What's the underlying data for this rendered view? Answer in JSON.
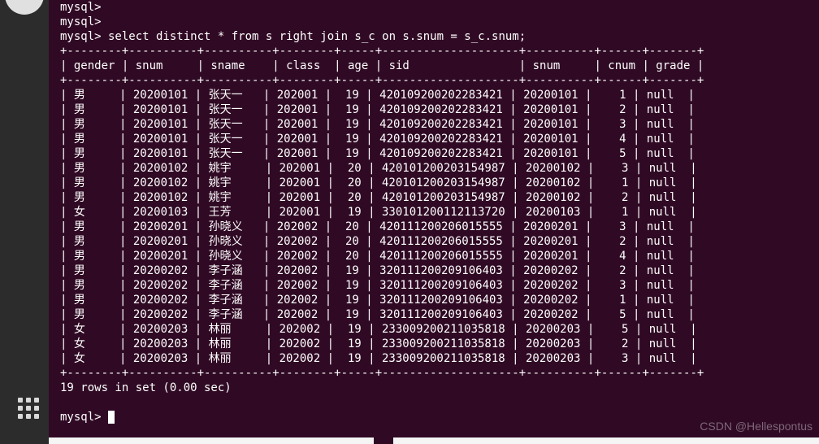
{
  "prompts": [
    "mysql>",
    "mysql>",
    "mysql> select distinct * from s right join s_c on s.snum = s_c.snum;"
  ],
  "table": {
    "headers": [
      "gender",
      "snum",
      "sname",
      "class",
      "age",
      "sid",
      "snum",
      "cnum",
      "grade"
    ],
    "rows": [
      [
        "男",
        "20200101",
        "张天一",
        "202001",
        "19",
        "420109200202283421",
        "20200101",
        "1",
        "null"
      ],
      [
        "男",
        "20200101",
        "张天一",
        "202001",
        "19",
        "420109200202283421",
        "20200101",
        "2",
        "null"
      ],
      [
        "男",
        "20200101",
        "张天一",
        "202001",
        "19",
        "420109200202283421",
        "20200101",
        "3",
        "null"
      ],
      [
        "男",
        "20200101",
        "张天一",
        "202001",
        "19",
        "420109200202283421",
        "20200101",
        "4",
        "null"
      ],
      [
        "男",
        "20200101",
        "张天一",
        "202001",
        "19",
        "420109200202283421",
        "20200101",
        "5",
        "null"
      ],
      [
        "男",
        "20200102",
        "姚宇",
        "202001",
        "20",
        "420101200203154987",
        "20200102",
        "3",
        "null"
      ],
      [
        "男",
        "20200102",
        "姚宇",
        "202001",
        "20",
        "420101200203154987",
        "20200102",
        "1",
        "null"
      ],
      [
        "男",
        "20200102",
        "姚宇",
        "202001",
        "20",
        "420101200203154987",
        "20200102",
        "2",
        "null"
      ],
      [
        "女",
        "20200103",
        "王芳",
        "202001",
        "19",
        "330101200112113720",
        "20200103",
        "1",
        "null"
      ],
      [
        "男",
        "20200201",
        "孙晓义",
        "202002",
        "20",
        "420111200206015555",
        "20200201",
        "3",
        "null"
      ],
      [
        "男",
        "20200201",
        "孙晓义",
        "202002",
        "20",
        "420111200206015555",
        "20200201",
        "2",
        "null"
      ],
      [
        "男",
        "20200201",
        "孙晓义",
        "202002",
        "20",
        "420111200206015555",
        "20200201",
        "4",
        "null"
      ],
      [
        "男",
        "20200202",
        "李子涵",
        "202002",
        "19",
        "320111200209106403",
        "20200202",
        "2",
        "null"
      ],
      [
        "男",
        "20200202",
        "李子涵",
        "202002",
        "19",
        "320111200209106403",
        "20200202",
        "3",
        "null"
      ],
      [
        "男",
        "20200202",
        "李子涵",
        "202002",
        "19",
        "320111200209106403",
        "20200202",
        "1",
        "null"
      ],
      [
        "男",
        "20200202",
        "李子涵",
        "202002",
        "19",
        "320111200209106403",
        "20200202",
        "5",
        "null"
      ],
      [
        "女",
        "20200203",
        "林丽",
        "202002",
        "19",
        "233009200211035818",
        "20200203",
        "5",
        "null"
      ],
      [
        "女",
        "20200203",
        "林丽",
        "202002",
        "19",
        "233009200211035818",
        "20200203",
        "2",
        "null"
      ],
      [
        "女",
        "20200203",
        "林丽",
        "202002",
        "19",
        "233009200211035818",
        "20200203",
        "3",
        "null"
      ]
    ]
  },
  "result_line": "19 rows in set (0.00 sec)",
  "final_prompt": "mysql> ",
  "watermark": "CSDN @Hellespontus",
  "widths": [
    8,
    10,
    10,
    8,
    5,
    20,
    10,
    6,
    7
  ]
}
